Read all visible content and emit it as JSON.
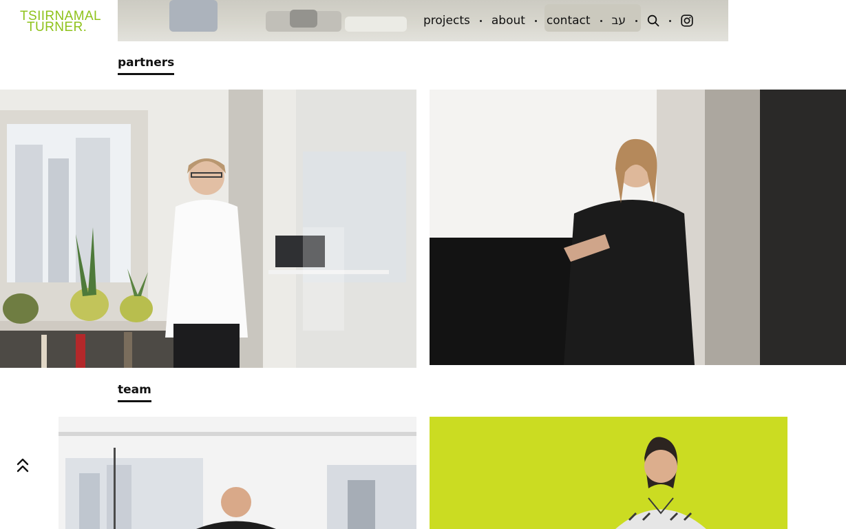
{
  "brand": {
    "logo_line1": "TSIIRNAMAL",
    "logo_line2": "TURNER.",
    "color": "#8ec21a"
  },
  "nav": {
    "items": [
      {
        "label": "projects"
      },
      {
        "label": "about"
      },
      {
        "label": "contact"
      },
      {
        "label": "עב"
      }
    ],
    "search_icon": "search-icon",
    "instagram_icon": "instagram-icon"
  },
  "sections": {
    "partners": {
      "title": "partners"
    },
    "team": {
      "title": "team"
    }
  },
  "back_to_top_icon": "double-chevron-up-icon",
  "colors": {
    "text": "#111111",
    "accent": "#8ec21a",
    "team_backdrop": "#cbdc22"
  }
}
